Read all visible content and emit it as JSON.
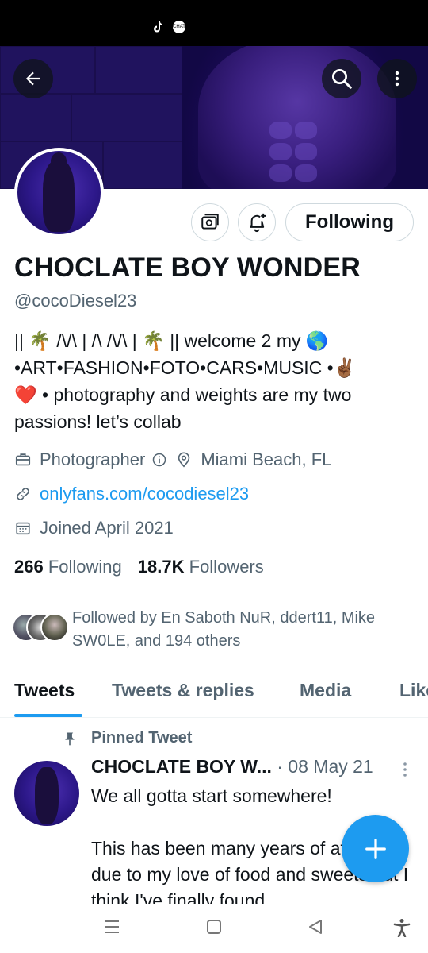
{
  "status_bar": {
    "tiktok_icon": "tiktok-icon",
    "message_icon": "message-icon",
    "message_icon_text": "CHAT"
  },
  "header": {
    "back_icon": "arrow-left-icon",
    "search_icon": "search-icon",
    "more_icon": "more-vertical-icon"
  },
  "profile": {
    "subscribe_icon": "subscription-icon",
    "notify_icon": "bell-plus-icon",
    "following_label": "Following",
    "display_name": "CHOCLATE BOY WONDER",
    "handle": "@cocoDiesel23",
    "bio_lines": [
      "|| 🌴 /\\/\\ | /\\ /\\/\\ | 🌴 || welcome 2 my 🌎",
      "•ART•FASHION•FOTO•CARS•MUSIC •✌🏾",
      "❤️ • photography and weights are my two",
      "passions! let’s collab"
    ],
    "category": "Photographer",
    "location": "Miami Beach, FL",
    "link": "onlyfans.com/cocodiesel23",
    "joined": "Joined April 2021",
    "following_count": "266",
    "followers_count": "18.7K",
    "followers_label": "Followers",
    "followed_by_line1": "Followed by En Saboth NuR, ddert11, Mike",
    "followed_by_line2": "SW0LE, and 194 others"
  },
  "tabs": [
    {
      "label": "Tweets",
      "active": true
    },
    {
      "label": "Tweets & replies",
      "active": false
    },
    {
      "label": "Media",
      "active": false
    },
    {
      "label": "Likes",
      "active": false
    }
  ],
  "tweet": {
    "pinned_label": "Pinned Tweet",
    "author": "CHOCLATE BOY W...",
    "date": "· 08 May 21",
    "body_p1": "We all gotta start somewhere!",
    "body_p2": "This has been many years of attempts due to my love of food and sweets but I think I've finally found"
  },
  "fab_icon": "plus-icon",
  "nav": {
    "recents_icon": "recents-icon",
    "home_icon": "home-icon",
    "back_icon": "back-triangle-icon",
    "accessibility_icon": "accessibility-icon"
  },
  "colors": {
    "accent": "#1d9bf0",
    "text": "#0f1419",
    "secondary": "#536471",
    "border": "#cfd9de"
  }
}
